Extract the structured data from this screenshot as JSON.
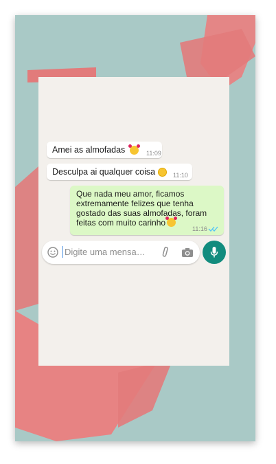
{
  "messages": [
    {
      "text": "Amei as almofadas",
      "time": "11:09",
      "emoji": "smiling-face-with-hearts"
    },
    {
      "text": "Desculpa ai qualquer coisa",
      "time": "11:10",
      "emoji": "upside-down-face"
    }
  ],
  "reply": {
    "lines": [
      "Que nada meu amor, ficamos",
      "extremamente felizes que tenha",
      "gostado das suas almofadas, foram",
      "feitas com muito carinho"
    ],
    "time": "11:16",
    "emoji": "smiling-face-with-hearts",
    "status_icon": "double-check-read-icon"
  },
  "input": {
    "placeholder": "Digite uma mensa…"
  },
  "icons": {
    "emoji": "emoji-icon",
    "attach": "paperclip-icon",
    "camera": "camera-icon",
    "mic": "mic-icon"
  },
  "colors": {
    "outgoing_bubble": "#dcf8c6",
    "send_button": "#128c7e",
    "background": "#a9c9c6",
    "brush": "#e78383"
  }
}
